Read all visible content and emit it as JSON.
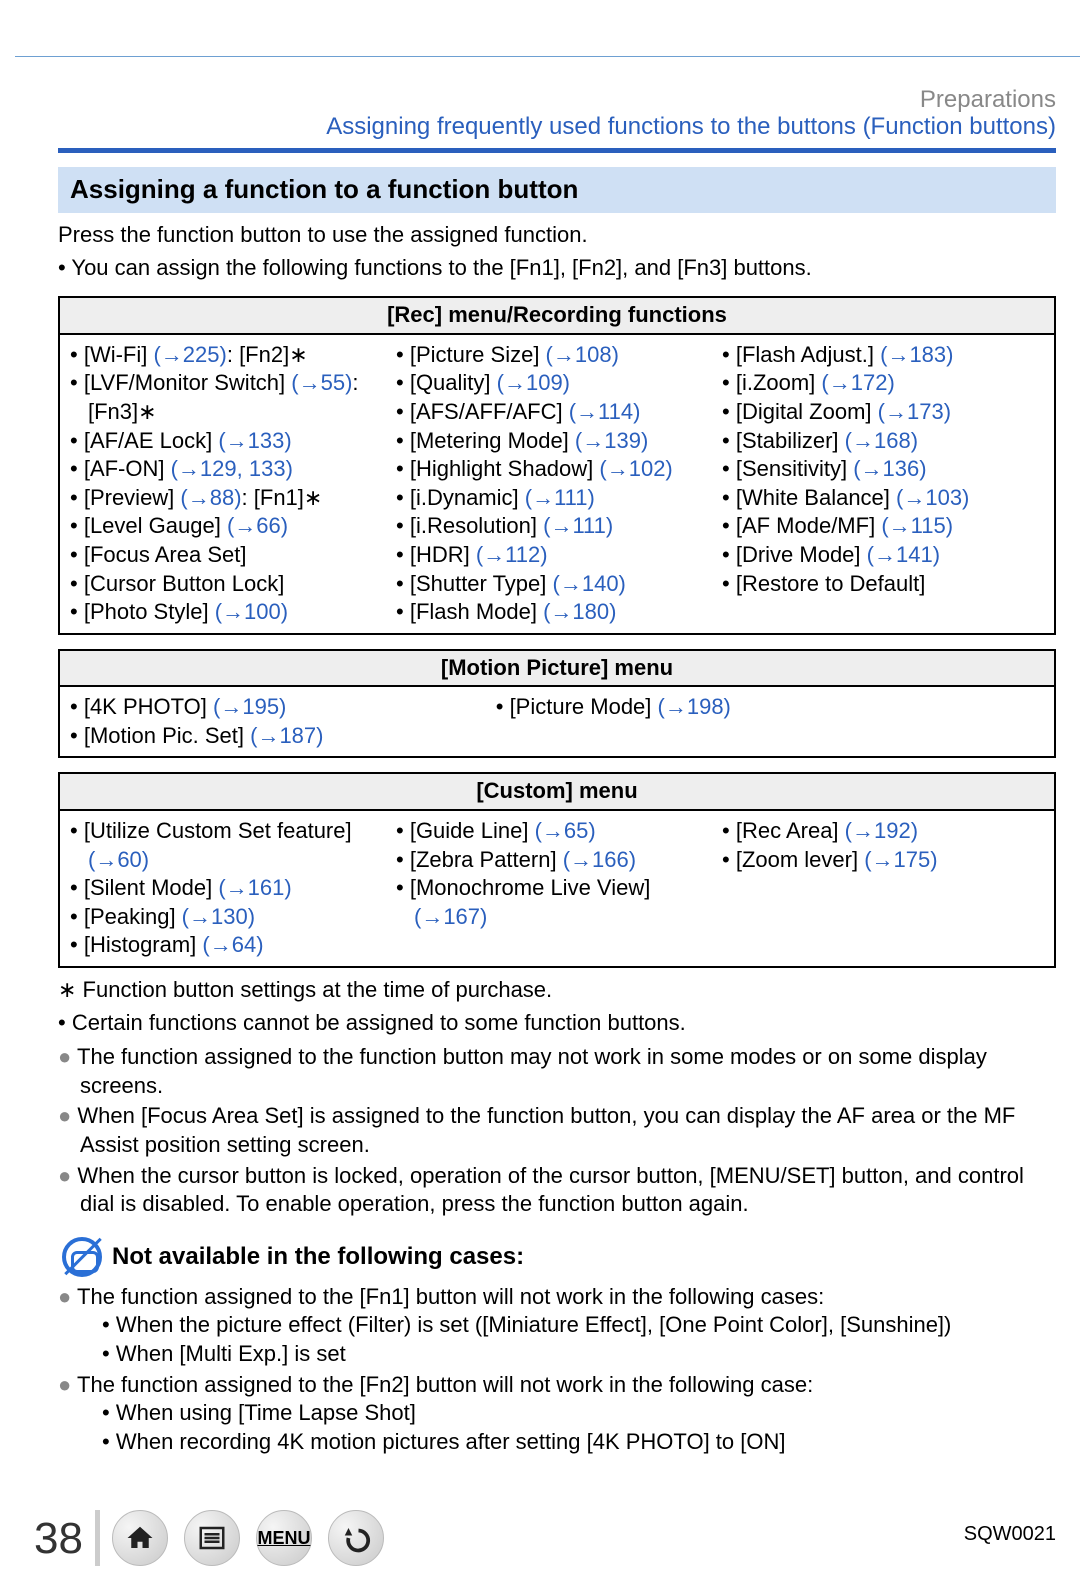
{
  "header_label": "Preparations",
  "section_title": "Assigning frequently used functions to the buttons  (Function buttons)",
  "sub_header": "Assigning a function to a function button",
  "intro_line": "Press the function button to use the assigned function.",
  "intro_bullet": "You can assign the following functions to the [Fn1], [Fn2], and [Fn3] buttons.",
  "rec_header": "[Rec] menu/Recording functions",
  "rec": {
    "col1": [
      {
        "label": "[Wi-Fi] ",
        "ref": "(→225)",
        "suffix": ": [Fn2]∗"
      },
      {
        "label": "[LVF/Monitor Switch] ",
        "ref": "(→55)",
        "suffix": ": [Fn3]∗"
      },
      {
        "label": "[AF/AE Lock] ",
        "ref": "(→133)",
        "suffix": ""
      },
      {
        "label": "[AF-ON] ",
        "ref": "(→129, 133)",
        "suffix": ""
      },
      {
        "label": "[Preview] ",
        "ref": "(→88)",
        "suffix": ": [Fn1]∗"
      },
      {
        "label": "[Level Gauge] ",
        "ref": "(→66)",
        "suffix": ""
      },
      {
        "label": "[Focus Area Set]",
        "ref": "",
        "suffix": ""
      },
      {
        "label": "[Cursor Button Lock]",
        "ref": "",
        "suffix": ""
      },
      {
        "label": "[Photo Style] ",
        "ref": "(→100)",
        "suffix": ""
      }
    ],
    "col2": [
      {
        "label": "[Picture Size] ",
        "ref": "(→108)"
      },
      {
        "label": "[Quality] ",
        "ref": "(→109)"
      },
      {
        "label": "[AFS/AFF/AFC] ",
        "ref": "(→114)"
      },
      {
        "label": "[Metering Mode] ",
        "ref": "(→139)"
      },
      {
        "label": "[Highlight Shadow] ",
        "ref": "(→102)"
      },
      {
        "label": "[i.Dynamic] ",
        "ref": "(→111)"
      },
      {
        "label": "[i.Resolution] ",
        "ref": "(→111)"
      },
      {
        "label": "[HDR] ",
        "ref": "(→112)"
      },
      {
        "label": "[Shutter Type] ",
        "ref": "(→140)"
      },
      {
        "label": "[Flash Mode] ",
        "ref": "(→180)"
      }
    ],
    "col3": [
      {
        "label": "[Flash Adjust.] ",
        "ref": "(→183)"
      },
      {
        "label": "[i.Zoom] ",
        "ref": "(→172)"
      },
      {
        "label": "[Digital Zoom] ",
        "ref": "(→173)"
      },
      {
        "label": "[Stabilizer] ",
        "ref": "(→168)"
      },
      {
        "label": "[Sensitivity] ",
        "ref": "(→136)"
      },
      {
        "label": "[White Balance] ",
        "ref": "(→103)"
      },
      {
        "label": "[AF Mode/MF] ",
        "ref": "(→115)"
      },
      {
        "label": "[Drive Mode] ",
        "ref": "(→141)"
      },
      {
        "label": "[Restore to Default]",
        "ref": ""
      }
    ]
  },
  "motion_header": "[Motion Picture] menu",
  "motion": {
    "col1": [
      {
        "label": "[4K PHOTO] ",
        "ref": "(→195)"
      },
      {
        "label": "[Motion Pic. Set] ",
        "ref": "(→187)"
      }
    ],
    "col2": [
      {
        "label": "[Picture Mode] ",
        "ref": "(→198)"
      }
    ]
  },
  "custom_header": "[Custom] menu",
  "custom": {
    "col1": [
      {
        "label": "[Utilize Custom Set feature] ",
        "ref": "(→60)"
      },
      {
        "label": "[Silent Mode] ",
        "ref": "(→161)"
      },
      {
        "label": "[Peaking] ",
        "ref": "(→130)"
      },
      {
        "label": "[Histogram] ",
        "ref": "(→64)"
      }
    ],
    "col2": [
      {
        "label": "[Guide Line] ",
        "ref": "(→65)"
      },
      {
        "label": "[Zebra Pattern] ",
        "ref": "(→166)"
      },
      {
        "label": "[Monochrome Live View] ",
        "ref": "(→167)"
      }
    ],
    "col3": [
      {
        "label": "[Rec Area] ",
        "ref": "(→192)"
      },
      {
        "label": "[Zoom lever] ",
        "ref": "(→175)"
      }
    ]
  },
  "footnote_star": "Function button settings at the time of purchase.",
  "footnote_bullet": "Certain functions cannot be assigned to some function buttons.",
  "notes": [
    "The function assigned to the function button may not work in some modes or on some display screens.",
    "When [Focus Area Set] is assigned to the function button, you can display the AF area or the MF Assist position setting screen.",
    "When the cursor button is locked, operation of the cursor button, [MENU/SET] button, and control dial is disabled. To enable operation, press the function button again."
  ],
  "na_header": "Not available in the following cases:",
  "na": {
    "fn1_intro": "The function assigned to the [Fn1] button will not work in the following cases:",
    "fn1_sub": [
      "When the picture effect (Filter) is set ([Miniature Effect], [One Point Color], [Sunshine])",
      "When [Multi Exp.] is set"
    ],
    "fn2_intro": "The function assigned to the [Fn2] button will not work in the following case:",
    "fn2_sub": [
      "When using [Time Lapse Shot]",
      "When recording 4K motion pictures after setting [4K PHOTO] to [ON]"
    ]
  },
  "page_number": "38",
  "menu_label": "MENU",
  "doc_code": "SQW0021"
}
